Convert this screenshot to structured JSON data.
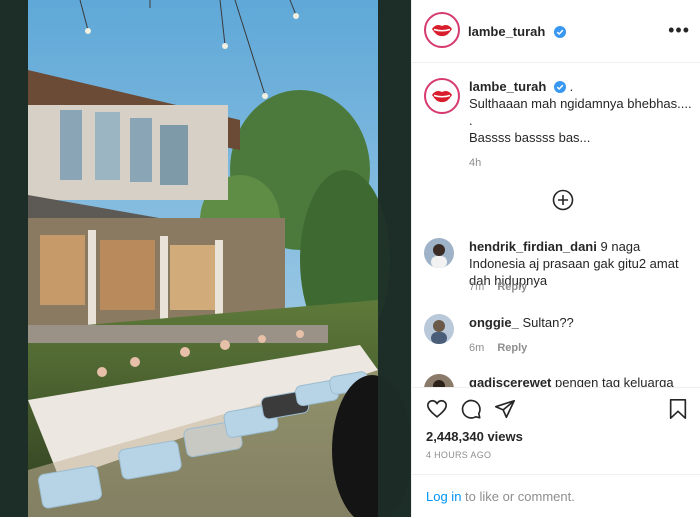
{
  "post": {
    "username": "lambe_turah",
    "caption_suffix": ".",
    "caption_lines": [
      "Sulthaaan mah ngidamnya bhebhas....",
      ".",
      "Bassss bassss bas..."
    ],
    "caption_time": "4h",
    "views": "2,448,340 views",
    "time_ago": "4 HOURS AGO",
    "login_link": "Log in",
    "login_rest": " to like or comment."
  },
  "comments": [
    {
      "username": "hendrik_firdian_dani",
      "text": "9 naga Indonesia aj prasaan gak gitu2 amat dah hidupnya",
      "time": "7m",
      "reply": "Reply"
    },
    {
      "username": "onggie_",
      "text": "Sultan??",
      "time": "6m",
      "reply": "Reply"
    },
    {
      "username": "gadiscerewet",
      "text": "pengen tag keluarga",
      "time": "",
      "reply": ""
    }
  ],
  "icons": {
    "more": "more-options-icon",
    "load": "load-more-comments-icon",
    "like": "heart-icon",
    "comment": "comment-icon",
    "share": "share-icon",
    "save": "bookmark-icon"
  },
  "colors": {
    "verified": "#3897f0",
    "link": "#0095f6",
    "muted": "#8e8e8e",
    "avatar_ring": "#d63a6f"
  }
}
